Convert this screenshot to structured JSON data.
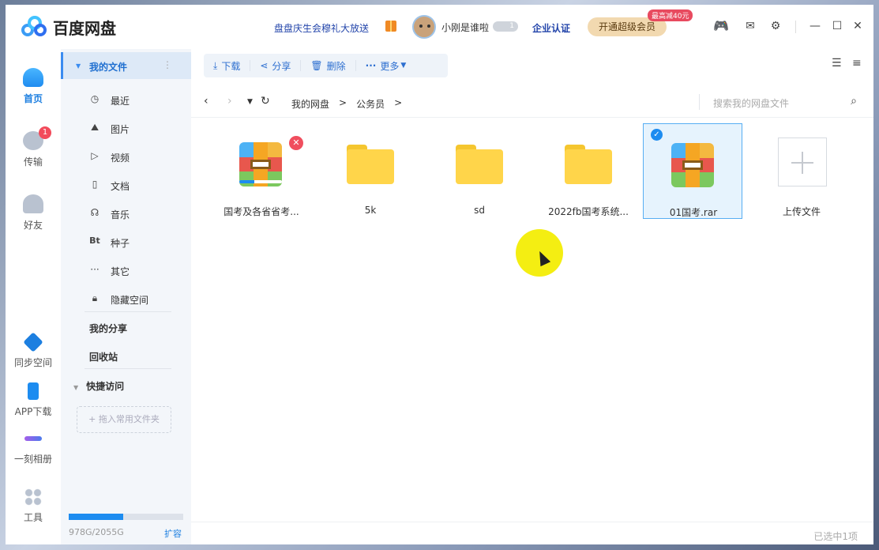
{
  "app": {
    "name": "百度网盘"
  },
  "header": {
    "promo": "盘盘庆生会穆礼大放送",
    "username": "小刚是谁啦",
    "vip_level": "1",
    "enterprise": "企业认证",
    "svip_button": "开通超级会员",
    "svip_tag": "最高减40元"
  },
  "rail": {
    "home": "首页",
    "transfer": "传输",
    "transfer_badge": "1",
    "friends": "好友",
    "sync": "同步空间",
    "app_download": "APP下载",
    "album": "一刻相册",
    "tools": "工具"
  },
  "sidebar": {
    "my_files": "我的文件",
    "items": [
      {
        "label": "最近",
        "icon": "clock-icon"
      },
      {
        "label": "图片",
        "icon": "image-icon"
      },
      {
        "label": "视频",
        "icon": "play-icon"
      },
      {
        "label": "文档",
        "icon": "document-icon"
      },
      {
        "label": "音乐",
        "icon": "headphones-icon"
      },
      {
        "label": "种子",
        "icon": "bt-icon"
      },
      {
        "label": "其它",
        "icon": "more-icon"
      },
      {
        "label": "隐藏空间",
        "icon": "lock-icon"
      }
    ],
    "bt_glyph": "Bt",
    "my_share": "我的分享",
    "recycle": "回收站",
    "quick_access": "快捷访问",
    "drop_hint": "+ 拖入常用文件夹",
    "quota": "978G/2055G",
    "quota_used_fraction": 0.476,
    "expand": "扩容"
  },
  "toolbar": {
    "download": "下载",
    "share": "分享",
    "delete": "删除",
    "more": "更多"
  },
  "path": {
    "crumbs": [
      "我的网盘",
      ">",
      "公务员",
      ">"
    ],
    "search_placeholder": "搜索我的网盘文件"
  },
  "files": [
    {
      "name": "国考及各省省考...",
      "type": "rar",
      "error": true,
      "progress": 0.35
    },
    {
      "name": "5k",
      "type": "folder"
    },
    {
      "name": "sd",
      "type": "folder"
    },
    {
      "name": "2022fb国考系统...",
      "type": "folder"
    },
    {
      "name": "01国考.rar",
      "type": "rar",
      "selected": true
    },
    {
      "name": "上传文件",
      "type": "upload"
    }
  ],
  "status": "已选中1项",
  "colors": {
    "accent": "#1d8cf0",
    "selected_bg": "#e6f3fd",
    "folder": "#ffd54a"
  }
}
